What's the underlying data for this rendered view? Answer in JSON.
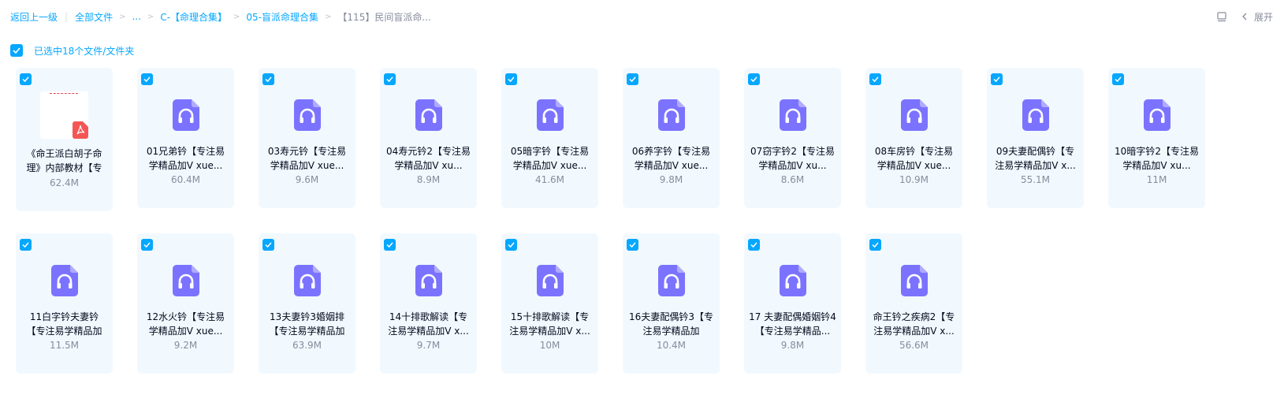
{
  "breadcrumb": {
    "back_label": "返回上一级",
    "all_files_label": "全部文件",
    "ellipsis": "...",
    "path": [
      "C-【命理合集】",
      "05-盲派命理合集"
    ],
    "current": "【115】民间盲派命..."
  },
  "toolbar": {
    "view_icon": "list-view-icon",
    "expand_label": "展开"
  },
  "selection": {
    "label": "已选中18个文件/文件夹"
  },
  "colors": {
    "accent": "#06a7ff",
    "card_bg": "#f1f9ff",
    "audio_icon": "#7b73ff",
    "pdf_badge": "#f45656"
  },
  "files": [
    {
      "name": "《命王派白胡子命理》内部教材【专",
      "size": "62.4M",
      "type": "pdf",
      "icon": "pdf-icon"
    },
    {
      "name": "01兄弟钤【专注易学精品加V xue...",
      "size": "60.4M",
      "type": "audio",
      "icon": "audio-file-icon"
    },
    {
      "name": "03寿元钤【专注易学精品加V xue...",
      "size": "9.6M",
      "type": "audio",
      "icon": "audio-file-icon"
    },
    {
      "name": "04寿元钤2【专注易学精品加V xu...",
      "size": "8.9M",
      "type": "audio",
      "icon": "audio-file-icon"
    },
    {
      "name": "05暗字钤【专注易学精品加V xue...",
      "size": "41.6M",
      "type": "audio",
      "icon": "audio-file-icon"
    },
    {
      "name": "06养字钤【专注易学精品加V xue...",
      "size": "9.8M",
      "type": "audio",
      "icon": "audio-file-icon"
    },
    {
      "name": "07窃字钤2【专注易学精品加V xu...",
      "size": "8.6M",
      "type": "audio",
      "icon": "audio-file-icon"
    },
    {
      "name": "08车房钤【专注易学精品加V xue...",
      "size": "10.9M",
      "type": "audio",
      "icon": "audio-file-icon"
    },
    {
      "name": "09夫妻配偶钤【专注易学精品加V x...",
      "size": "55.1M",
      "type": "audio",
      "icon": "audio-file-icon"
    },
    {
      "name": "10暗字钤2【专注易学精品加V xu...",
      "size": "11M",
      "type": "audio",
      "icon": "audio-file-icon"
    },
    {
      "name": "11白字钤夫妻钤【专注易学精品加",
      "size": "11.5M",
      "type": "audio",
      "icon": "audio-file-icon"
    },
    {
      "name": "12水火钤【专注易学精品加V xue...",
      "size": "9.2M",
      "type": "audio",
      "icon": "audio-file-icon"
    },
    {
      "name": "13夫妻钤3婚姻排【专注易学精品加",
      "size": "63.9M",
      "type": "audio",
      "icon": "audio-file-icon"
    },
    {
      "name": "14十排歌解读【专注易学精品加V x...",
      "size": "9.7M",
      "type": "audio",
      "icon": "audio-file-icon"
    },
    {
      "name": "15十排歌解读【专注易学精品加V x...",
      "size": "10M",
      "type": "audio",
      "icon": "audio-file-icon"
    },
    {
      "name": "16夫妻配偶钤3【专注易学精品加",
      "size": "10.4M",
      "type": "audio",
      "icon": "audio-file-icon"
    },
    {
      "name": "17 夫妻配偶婚姻钤4【专注易学精品...",
      "size": "9.8M",
      "type": "audio",
      "icon": "audio-file-icon"
    },
    {
      "name": "命王钤之疾病2【专注易学精品加V x...",
      "size": "56.6M",
      "type": "audio",
      "icon": "audio-file-icon"
    }
  ]
}
